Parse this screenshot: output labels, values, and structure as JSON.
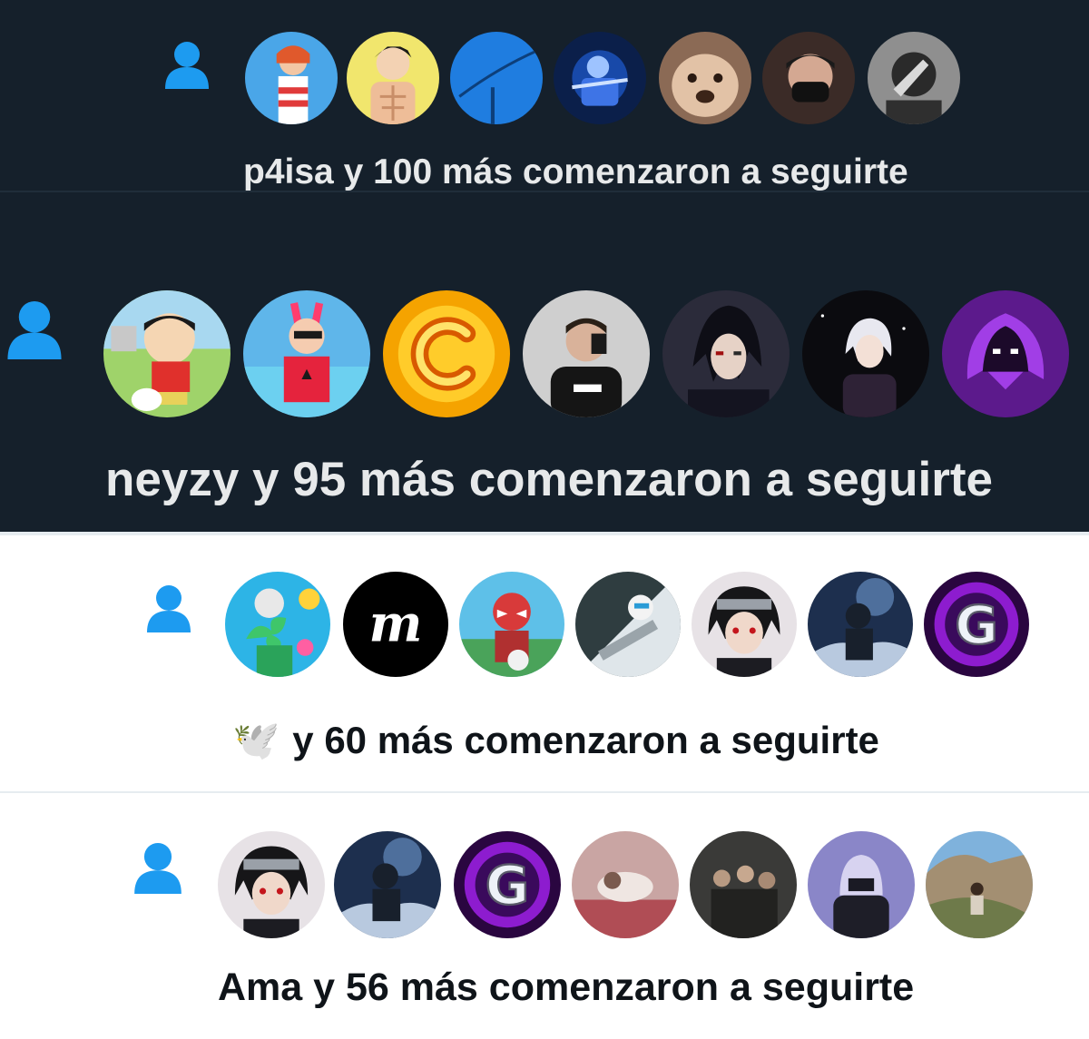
{
  "colors": {
    "dark_background": "#15202b",
    "light_background": "#ffffff",
    "accent_blue": "#1d9bf0",
    "dark_text": "#e7e9ea",
    "light_text": "#0f1419"
  },
  "notifications": [
    {
      "icon": "person-icon",
      "avatars": [
        "fortnite-skin-avatar",
        "anime-muscle-avatar",
        "blue-sky-avatar",
        "blue-gamer-avatar",
        "bulldog-avatar",
        "masked-person-avatar",
        "grey-hand-avatar"
      ],
      "text": "p4isa y 100 más comenzaron a seguirte"
    },
    {
      "icon": "person-icon",
      "avatars": [
        "shinchan-avatar",
        "bunny-skin-avatar",
        "orange-c-logo-avatar",
        "mirror-selfie-avatar",
        "dark-anime-avatar",
        "white-hair-anime-avatar",
        "purple-raven-avatar"
      ],
      "text": "neyzy y 95 más comenzaron a seguirte"
    },
    {
      "icon": "person-icon",
      "avatars": [
        "clover-skin-avatar",
        "m-logo-avatar",
        "luchador-skin-avatar",
        "white-armor-avatar",
        "itachi-avatar",
        "stormy-character-avatar",
        "g-logo-avatar"
      ],
      "lead_emoji": "🕊️",
      "text": "y 60 más comenzaron a seguirte"
    },
    {
      "icon": "person-icon",
      "avatars": [
        "itachi-avatar",
        "stormy-character-avatar",
        "g-logo-avatar",
        "dim-photo-avatar",
        "group-photo-avatar",
        "hooded-anime-avatar",
        "rocks-photo-avatar"
      ],
      "text": "Ama y 56 más comenzaron a seguirte"
    }
  ]
}
